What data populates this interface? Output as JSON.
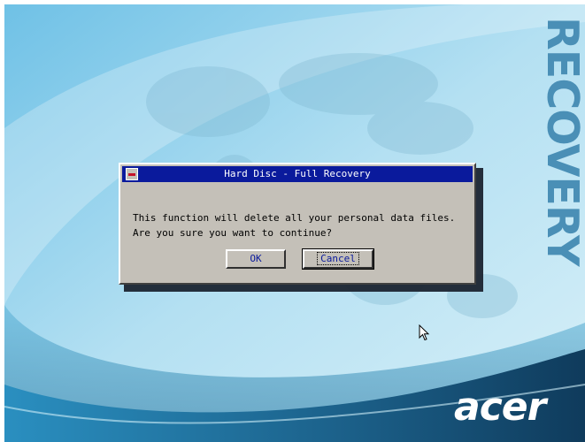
{
  "dialog": {
    "title": "Hard Disc - Full Recovery",
    "message": "This function will delete all your personal data files.\nAre you sure you want to continue?",
    "ok_label": "OK",
    "cancel_label": "Cancel",
    "system_menu_icon": "minus-icon"
  },
  "branding": {
    "vertical_text": "RECOVERY",
    "logo_text": "acer"
  },
  "colors": {
    "title_bar": "#0a1a9c",
    "dialog_face": "#c4c0b8",
    "brand_text": "#4a8fb6"
  }
}
